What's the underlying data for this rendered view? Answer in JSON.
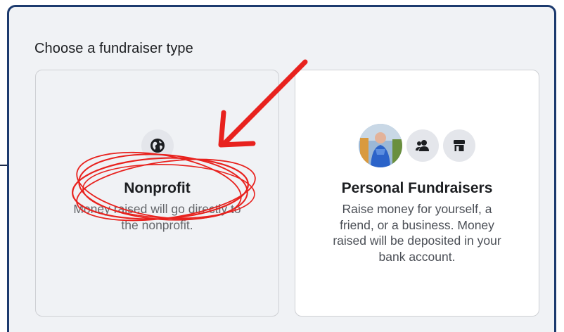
{
  "dialog": {
    "heading": "Choose a fundraiser type"
  },
  "cards": {
    "nonprofit": {
      "title": "Nonprofit",
      "description_lines": [
        "Money raised will go directly to",
        "the nonprofit."
      ],
      "icon": "globe-icon"
    },
    "personal": {
      "title": "Personal Fundraisers",
      "description_lines": [
        "Raise money for yourself, a",
        "friend, or a business. Money",
        "raised will be deposited in your",
        "bank account."
      ],
      "icons": [
        "avatar",
        "people-icon",
        "store-icon"
      ]
    }
  },
  "annotation": {
    "color": "#e8221e"
  },
  "colors": {
    "frame_border": "#1c3a6e",
    "dialog_bg": "#f0f2f5",
    "icon_bg": "#e4e6eb"
  }
}
